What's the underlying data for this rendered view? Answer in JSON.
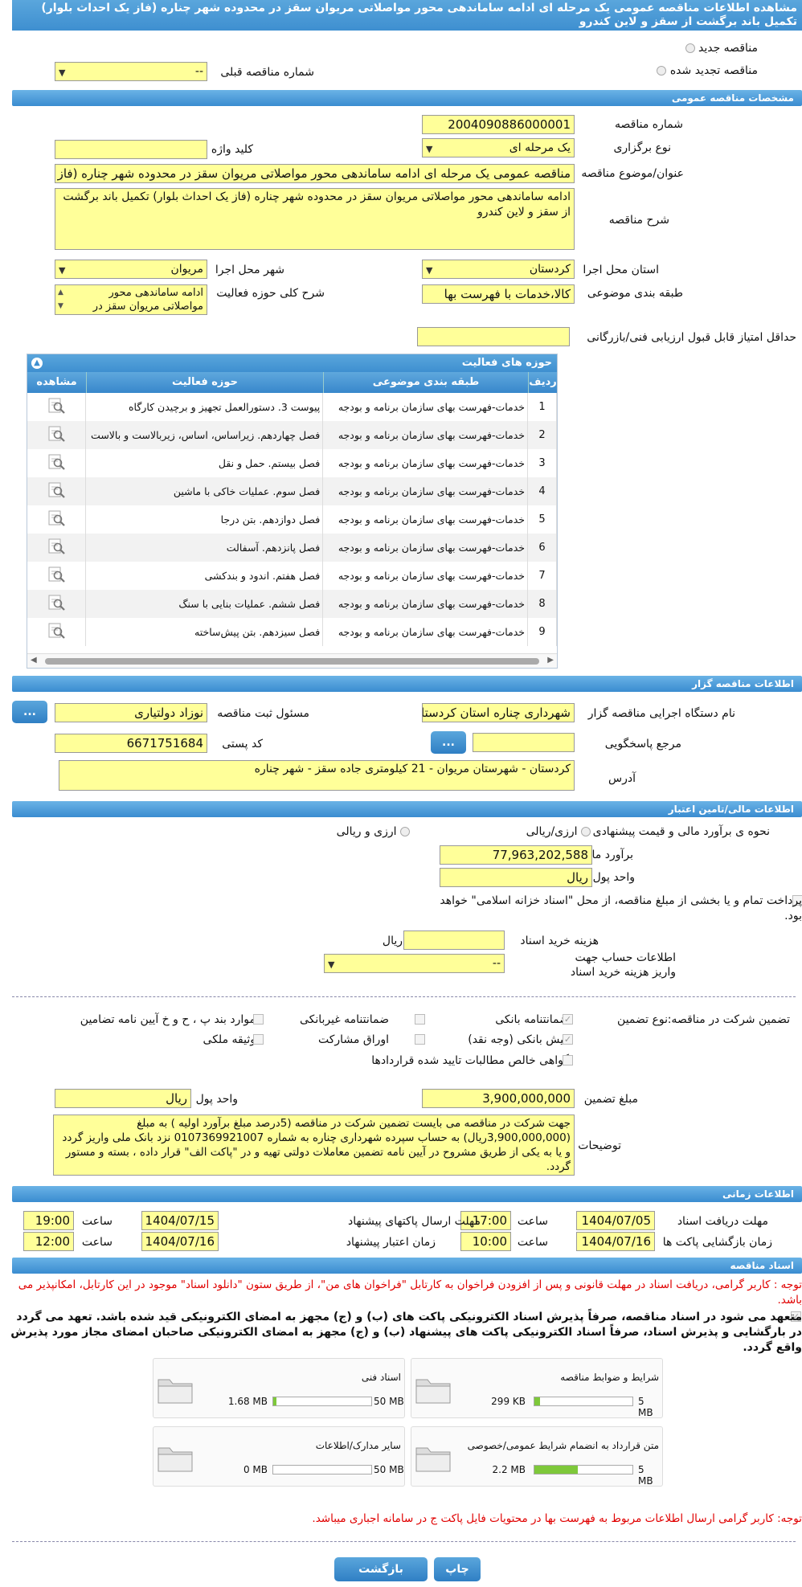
{
  "page_title": "مشاهده اطلاعات مناقصه عمومی یک مرحله ای ادامه ساماندهی محور مواصلاتی مریوان سقز در محدوده شهر چناره (فاز یک احداث بلوار) تکمیل باند برگشت از سقز و لاین کندرو",
  "top": {
    "new_tender": "مناقصه جدید",
    "renewed_tender": "مناقصه تجدید شده",
    "prev_number_label": "شماره مناقصه قبلی",
    "prev_number_value": "--"
  },
  "general": {
    "section": "مشخصات مناقصه عمومی",
    "number_label": "شماره مناقصه",
    "number": "2004090886000001",
    "type_label": "نوع برگزاری",
    "type": "یک مرحله ای",
    "keyword_label": "کلید واژه",
    "keyword": "",
    "subject_label": "عنوان/موضوع مناقصه",
    "subject": "مناقصه عمومی یک مرحله ای ادامه ساماندهی محور مواصلاتی مریوان  سقز در محدوده شهر چناره (فاز یک احداث بلوار)",
    "desc_label": "شرح مناقصه",
    "desc": "ادامه ساماندهی محور مواصلاتی مریوان  سقز در محدوده شهر چناره (فاز یک احداث بلوار) تکمیل باند برگشت از سقز و لاین کندرو",
    "province_label": "استان محل اجرا",
    "province": "کردستان",
    "city_label": "شهر محل اجرا",
    "city": "مریوان",
    "category_label": "طبقه بندی موضوعی",
    "category": "کالا،خدمات با فهرست بها",
    "scope_label": "شرح کلی حوزه فعالیت",
    "scope": "ادامه ساماندهی محور مواصلاتی مریوان  سقز در",
    "min_score_label": "حداقل امتیاز قابل قبول ارزیابی فنی/بازرگانی",
    "min_score": ""
  },
  "activity": {
    "title": "حوزه های فعالیت",
    "headers": {
      "row": "ردیف",
      "category": "طبقه بندی موضوعی",
      "field": "حوزه فعالیت",
      "view": "مشاهده"
    },
    "rows": [
      {
        "n": "1",
        "category": "خدمات-فهرست بهای سازمان برنامه و بودجه",
        "field": "پیوست 3. دستورالعمل تجهیز و برچیدن کارگاه"
      },
      {
        "n": "2",
        "category": "خدمات-فهرست بهای سازمان برنامه و بودجه",
        "field": "فصل چهاردهم. زیراساس، اساس، زیربالاست  و بالاست"
      },
      {
        "n": "3",
        "category": "خدمات-فهرست بهای سازمان برنامه و بودجه",
        "field": "فصل بیستم. حمل و نقل"
      },
      {
        "n": "4",
        "category": "خدمات-فهرست بهای سازمان برنامه و بودجه",
        "field": "فصل سوم. عملیات خاکی با ماشین"
      },
      {
        "n": "5",
        "category": "خدمات-فهرست بهای سازمان برنامه و بودجه",
        "field": "فصل دوازدهم. بتن درجا"
      },
      {
        "n": "6",
        "category": "خدمات-فهرست بهای سازمان برنامه و بودجه",
        "field": "فصل پانزدهم. آسفالت"
      },
      {
        "n": "7",
        "category": "خدمات-فهرست بهای سازمان برنامه و بودجه",
        "field": "فصل هفتم. اندود و بندکشی"
      },
      {
        "n": "8",
        "category": "خدمات-فهرست بهای سازمان برنامه و بودجه",
        "field": "فصل ششم. عملیات بنایی با سنگ"
      },
      {
        "n": "9",
        "category": "خدمات-فهرست بهای سازمان برنامه و بودجه",
        "field": "فصل سیزدهم. بتن پیش‌ساخته"
      }
    ]
  },
  "org": {
    "section": "اطلاعات مناقصه گزار",
    "name_label": "نام دستگاه اجرایی مناقصه گزار",
    "name": "شهرداری چناره استان کردستان",
    "resp_label": "مسئول ثبت مناقصه",
    "resp": "نوزاد دولتیاری",
    "ref_label": "مرجع پاسخگویی",
    "ref": "",
    "postal_label": "کد پستی",
    "postal": "6671751684",
    "addr_label": "آدرس",
    "addr": "کردستان - شهرستان مریوان - 21 کیلومتری جاده سقز - شهر چناره",
    "dots": "..."
  },
  "finance": {
    "section": "اطلاعات مالی/تامین اعتبار",
    "method_label": "نحوه ی برآورد مالی و قیمت پیشنهادی",
    "opt1": "ارزی/ریالی",
    "opt2": "ارزی و ریالی",
    "estimate_label": "برآورد مالی",
    "estimate": "77,963,202,588",
    "currency_label": "واحد پول",
    "currency": "ریال",
    "treasury": "پرداخت تمام و یا بخشی از مبلغ مناقصه، از محل \"اسناد خزانه اسلامی\" خواهد بود.",
    "doc_cost_label": "هزینه خرید اسناد",
    "doc_cost": "",
    "doc_cost_unit": "ریال",
    "account_label": "اطلاعات حساب جهت واریز هزینه خرید اسناد",
    "account": "--"
  },
  "guarantee": {
    "label1": "تضمین شرکت در مناقصه:",
    "label2": "نوع تضمین",
    "opts": [
      "ضمانتنامه بانکی",
      "ضمانتنامه غیربانکی",
      "موارد بند پ ، ح و خ آیین نامه تضامین",
      "فیش بانکی (وجه نقد)",
      "اوراق مشارکت",
      "وثیقه ملکی",
      "گواهی خالص مطالبات تایید شده قراردادها"
    ],
    "amount_label": "مبلغ تضمین",
    "amount": "3,900,000,000",
    "currency_label": "واحد پول",
    "currency": "ریال",
    "notes_label": "توضیحات",
    "notes": "جهت شرکت در مناقصه می بایست تضمین شرکت در مناقصه (5درصد مبلغ برآورد اولیه ) به مبلغ (3,900,000,000ریال) به حساب سپرده شهرداری چناره به شماره 0107369921007 نزد بانک ملی واریز گردد و یا به یکی از طریق مشروح در آیین نامه تضمین معاملات دولتی تهیه و در \"پاکت الف\" قرار داده ، بسته و مستور گردد."
  },
  "timing": {
    "section": "اطلاعات زمانی",
    "receive_label": "مهلت دریافت اسناد",
    "receive_date": "1404/07/05",
    "receive_time": "17:00",
    "send_label": "مهلت ارسال پاکتهای پیشنهاد",
    "send_date": "1404/07/15",
    "send_time": "19:00",
    "open_label": "زمان بازگشایی پاکت ها",
    "open_date": "1404/07/16",
    "open_time": "10:00",
    "valid_label": "زمان اعتبار پیشنهاد",
    "valid_date": "1404/07/16",
    "valid_time": "12:00",
    "time_label": "ساعت"
  },
  "docs": {
    "section": "اسناد مناقصه",
    "note1": "توجه : کاربر گرامی، دریافت اسناد در مهلت قانونی و پس از افزودن فراخوان به کارتابل \"فراخوان های من\"، از طریق ستون \"دانلود اسناد\" موجود در این کارتابل، امکانپذیر می باشد.",
    "commit": "متعهد می شود در اسناد مناقصه، صرفاً پذیرش اسناد الکترونیکی پاکت های (ب) و (ج) مجهز به امضای الکترونیکی قید شده باشد. تعهد می گردد در بارگشایی و پذیرش اسناد، صرفاً اسناد الکترونیکی پاکت های پیشنهاد (ب) و (ج) مجهز به امضای الکترونیکی صاحبان امضای مجاز مورد پذیرش واقع گردد.",
    "items": [
      {
        "name": "شرایط و ضوابط مناقصه",
        "size": "299 KB",
        "max": "5 MB",
        "fill": 0.06
      },
      {
        "name": "اسناد فنی",
        "size": "1.68 MB",
        "max": "50 MB",
        "fill": 0.03
      },
      {
        "name": "متن قرارداد به انضمام شرایط عمومی/خصوصی",
        "size": "2.2 MB",
        "max": "5 MB",
        "fill": 0.44
      },
      {
        "name": "سایر مدارک/اطلاعات",
        "size": "0 MB",
        "max": "50 MB",
        "fill": 0
      }
    ],
    "note2": "توجه: کاربر گرامی ارسال اطلاعات مربوط به فهرست بها در محتویات فایل پاکت ج در سامانه اجباری میباشد."
  },
  "buttons": {
    "print": "چاپ",
    "back": "بازگشت"
  },
  "colors": {
    "field": "#ffff99",
    "header": "#3e8fd0",
    "red": "#e00000"
  }
}
